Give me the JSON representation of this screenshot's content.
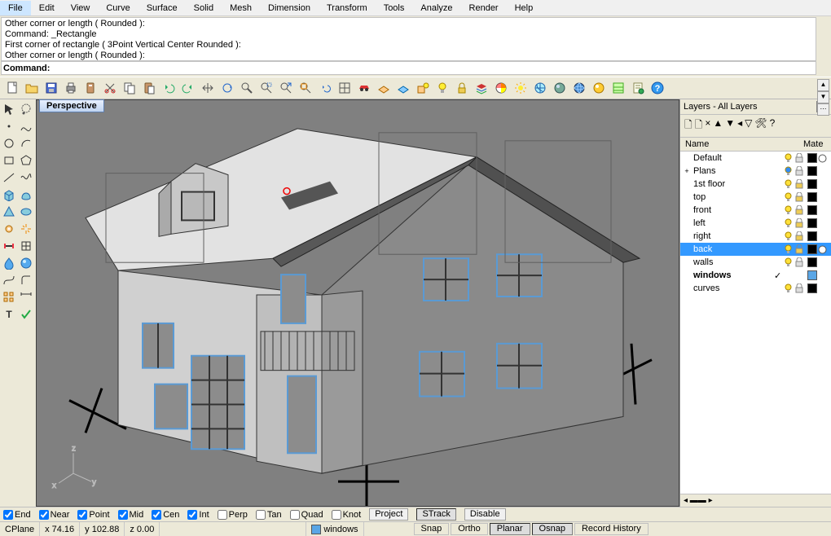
{
  "menu": [
    "File",
    "Edit",
    "View",
    "Curve",
    "Surface",
    "Solid",
    "Mesh",
    "Dimension",
    "Transform",
    "Tools",
    "Analyze",
    "Render",
    "Help"
  ],
  "cmd_history": [
    "Other corner or length ( Rounded ):",
    "Command: _Rectangle",
    "First corner of rectangle ( 3Point  Vertical  Center  Rounded ):",
    "Other corner or length ( Rounded ):"
  ],
  "cmd_label": "Command:",
  "cmd_value": "",
  "viewport_label": "Perspective",
  "layers_panel": {
    "title": "Layers - All Layers",
    "header_name": "Name",
    "header_mate": "Mate",
    "items": [
      {
        "name": "Default",
        "expand": "",
        "bulb": "#ffe13a",
        "lock": true,
        "color": "#000000",
        "mat": "circle"
      },
      {
        "name": "Plans",
        "expand": "+",
        "bulb": "#2f8cff",
        "lock": true,
        "color": "#000000",
        "mat": ""
      },
      {
        "name": "1st floor",
        "expand": "",
        "bulb": "#ffe13a",
        "lock": "locked",
        "color": "#000000",
        "mat": ""
      },
      {
        "name": "top",
        "expand": "",
        "bulb": "#ffe13a",
        "lock": "locked",
        "color": "#000000",
        "mat": ""
      },
      {
        "name": "front",
        "expand": "",
        "bulb": "#ffe13a",
        "lock": "locked",
        "color": "#000000",
        "mat": ""
      },
      {
        "name": "left",
        "expand": "",
        "bulb": "#ffe13a",
        "lock": "locked",
        "color": "#000000",
        "mat": ""
      },
      {
        "name": "right",
        "expand": "",
        "bulb": "#ffe13a",
        "lock": "locked",
        "color": "#000000",
        "mat": ""
      },
      {
        "name": "back",
        "expand": "",
        "bulb": "#ffe13a",
        "lock": "locked",
        "color": "#000000",
        "mat": "circle",
        "selected": true
      },
      {
        "name": "walls",
        "expand": "",
        "bulb": "#ffe13a",
        "lock": true,
        "color": "#000000",
        "mat": ""
      },
      {
        "name": "windows",
        "expand": "",
        "check": true,
        "bulb": "",
        "lock": false,
        "color": "#5aa6e6",
        "mat": "",
        "bold": true
      },
      {
        "name": "curves",
        "expand": "",
        "bulb": "#ffe13a",
        "lock": true,
        "color": "#000000",
        "mat": ""
      }
    ]
  },
  "osnap": {
    "items": [
      {
        "label": "End",
        "on": true
      },
      {
        "label": "Near",
        "on": true
      },
      {
        "label": "Point",
        "on": true
      },
      {
        "label": "Mid",
        "on": true
      },
      {
        "label": "Cen",
        "on": true
      },
      {
        "label": "Int",
        "on": true
      },
      {
        "label": "Perp",
        "on": false
      },
      {
        "label": "Tan",
        "on": false
      },
      {
        "label": "Quad",
        "on": false
      },
      {
        "label": "Knot",
        "on": false
      }
    ],
    "project": "Project",
    "strack": "STrack",
    "disable": "Disable"
  },
  "status": {
    "cplane": "CPlane",
    "x": "x 74.16",
    "y": "y 102.88",
    "z": "z 0.00",
    "layer": "windows",
    "layer_color": "#5aa6e6",
    "toggles": [
      {
        "label": "Snap",
        "on": false
      },
      {
        "label": "Ortho",
        "on": false
      },
      {
        "label": "Planar",
        "on": true
      },
      {
        "label": "Osnap",
        "on": true
      },
      {
        "label": "Record History",
        "on": false
      }
    ]
  }
}
